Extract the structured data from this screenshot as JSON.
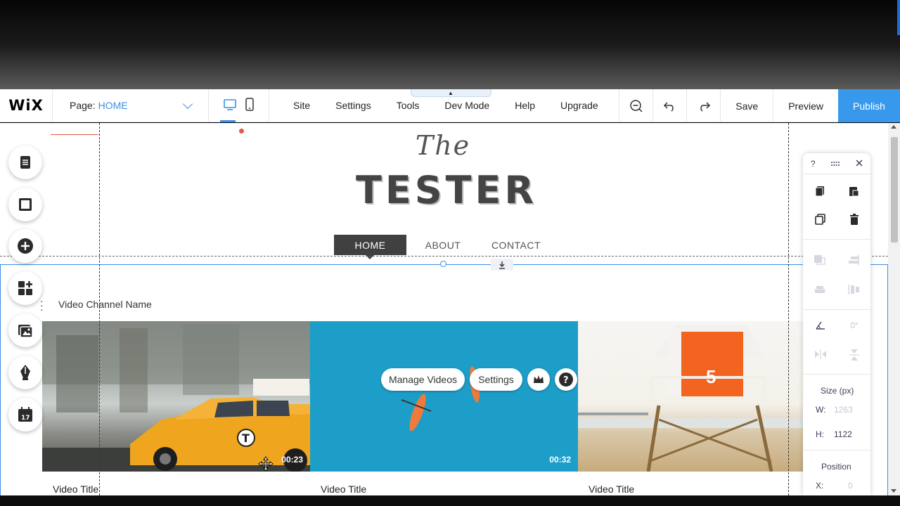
{
  "topbar": {
    "logo": "WiX",
    "page_label": "Page:",
    "page_value": "HOME",
    "menu": [
      "Site",
      "Settings",
      "Tools",
      "Dev Mode",
      "Help",
      "Upgrade"
    ],
    "save": "Save",
    "preview": "Preview",
    "publish": "Publish"
  },
  "site": {
    "title_small": "The",
    "title_large": "TESTER",
    "nav": [
      "HOME",
      "ABOUT",
      "CONTACT"
    ]
  },
  "gallery": {
    "channel_name": "Video Channel Name",
    "videos": [
      {
        "title": "Video Title",
        "duration": "00:23"
      },
      {
        "title": "Video Title",
        "duration": "00:32"
      },
      {
        "title": "Video Title",
        "duration": ""
      }
    ],
    "overlay": {
      "manage": "Manage Videos",
      "settings": "Settings"
    },
    "tower_number": "5"
  },
  "panel": {
    "help": "?",
    "rotation": "0°",
    "size_title": "Size (px)",
    "w_label": "W:",
    "w_value": "1263",
    "h_label": "H:",
    "h_value": "1122",
    "position_title": "Position",
    "x_label": "X:",
    "x_value": "0"
  },
  "colors": {
    "accent": "#3899ec",
    "selection": "#3b8fe8",
    "marker": "#e4574a"
  }
}
